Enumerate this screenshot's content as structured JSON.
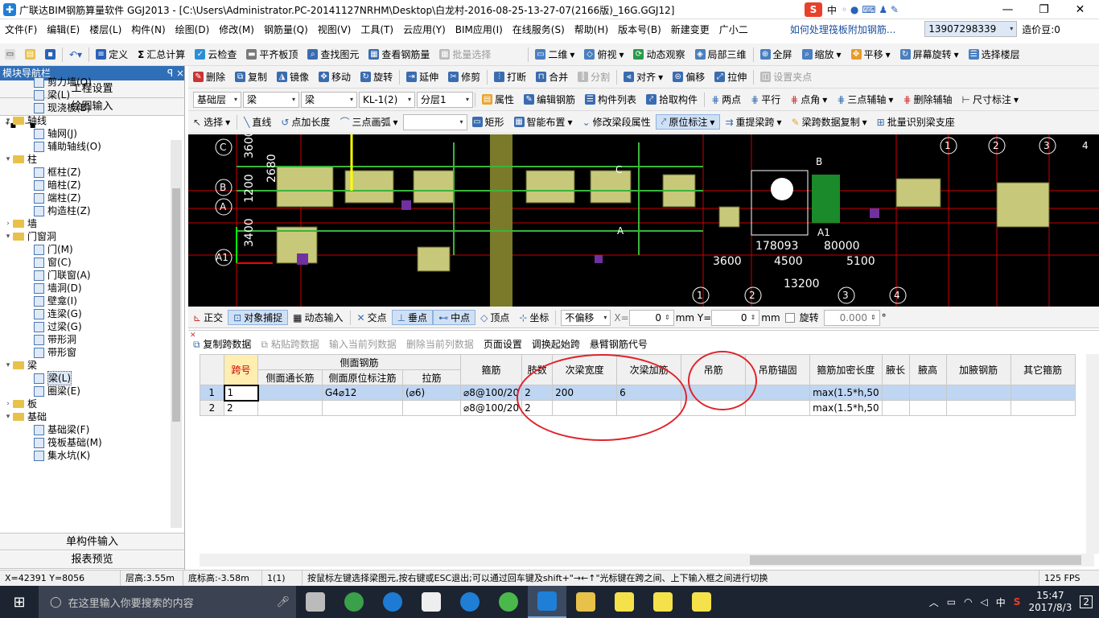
{
  "titlebar": {
    "title": "广联达BIM钢筋算量软件 GGJ2013 - [C:\\Users\\Administrator.PC-20141127NRHM\\Desktop\\白龙村-2016-08-25-13-27-07(2166版)_16G.GGJ12]",
    "ime_label": "中",
    "min": "—",
    "max": "❐",
    "close": "✕"
  },
  "menubar": {
    "items": [
      "文件(F)",
      "编辑(E)",
      "楼层(L)",
      "构件(N)",
      "绘图(D)",
      "修改(M)",
      "钢筋量(Q)",
      "视图(V)",
      "工具(T)",
      "云应用(Y)",
      "BIM应用(I)",
      "在线服务(S)",
      "帮助(H)",
      "版本号(B)",
      "新建变更",
      "广小二"
    ],
    "help_link": "如何处理筏板附加钢筋...",
    "phone": "13907298339",
    "price": "造价豆:0"
  },
  "toolbar1": {
    "items": [
      "定义",
      "汇总计算",
      "云检查",
      "平齐板顶",
      "查找图元",
      "查看钢筋量",
      "批量选择",
      "二维",
      "俯视",
      "动态观察",
      "局部三维",
      "全屏",
      "缩放",
      "平移",
      "屏幕旋转",
      "选择楼层"
    ]
  },
  "toolbar2": {
    "items": [
      "删除",
      "复制",
      "镜像",
      "移动",
      "旋转",
      "延伸",
      "修剪",
      "打断",
      "合并",
      "分割",
      "对齐",
      "偏移",
      "拉伸",
      "设置夹点"
    ]
  },
  "toolbar3": {
    "floor": "基础层",
    "type1": "梁",
    "type2": "梁",
    "component": "KL-1(2)",
    "layer": "分层1",
    "items": [
      "属性",
      "编辑钢筋",
      "构件列表",
      "拾取构件",
      "两点",
      "平行",
      "点角",
      "三点辅轴",
      "删除辅轴",
      "尺寸标注"
    ]
  },
  "toolbar4": {
    "items": [
      "选择",
      "直线",
      "点加长度",
      "三点画弧",
      "矩形",
      "智能布置",
      "修改梁段属性",
      "原位标注",
      "重提梁跨",
      "梁跨数据复制",
      "批量识别梁支座"
    ]
  },
  "leftpanel": {
    "header": "模块导航栏",
    "pin": "ꟼ ×",
    "btn_project": "工程设置",
    "btn_draw": "绘图输入",
    "btn_single": "单构件输入",
    "btn_report": "报表预览",
    "tree": [
      {
        "level": 2,
        "kind": "leaf",
        "label": "剪力墙(Q)"
      },
      {
        "level": 2,
        "kind": "leaf",
        "label": "梁(L)"
      },
      {
        "level": 2,
        "kind": "leaf",
        "label": "现浇板(B)"
      },
      {
        "level": 1,
        "kind": "folder",
        "label": "轴线",
        "exp": "▾"
      },
      {
        "level": 2,
        "kind": "leaf",
        "label": "轴网(J)"
      },
      {
        "level": 2,
        "kind": "leaf",
        "label": "辅助轴线(O)"
      },
      {
        "level": 1,
        "kind": "folder",
        "label": "柱",
        "exp": "▾"
      },
      {
        "level": 2,
        "kind": "leaf",
        "label": "框柱(Z)"
      },
      {
        "level": 2,
        "kind": "leaf",
        "label": "暗柱(Z)"
      },
      {
        "level": 2,
        "kind": "leaf",
        "label": "端柱(Z)"
      },
      {
        "level": 2,
        "kind": "leaf",
        "label": "构造柱(Z)"
      },
      {
        "level": 1,
        "kind": "folder",
        "label": "墙",
        "exp": "›"
      },
      {
        "level": 1,
        "kind": "folder",
        "label": "门窗洞",
        "exp": "▾"
      },
      {
        "level": 2,
        "kind": "leaf",
        "label": "门(M)"
      },
      {
        "level": 2,
        "kind": "leaf",
        "label": "窗(C)"
      },
      {
        "level": 2,
        "kind": "leaf",
        "label": "门联窗(A)"
      },
      {
        "level": 2,
        "kind": "leaf",
        "label": "墙洞(D)"
      },
      {
        "level": 2,
        "kind": "leaf",
        "label": "壁龛(I)"
      },
      {
        "level": 2,
        "kind": "leaf",
        "label": "连梁(G)"
      },
      {
        "level": 2,
        "kind": "leaf",
        "label": "过梁(G)"
      },
      {
        "level": 2,
        "kind": "leaf",
        "label": "带形洞"
      },
      {
        "level": 2,
        "kind": "leaf",
        "label": "带形窗"
      },
      {
        "level": 1,
        "kind": "folder",
        "label": "梁",
        "exp": "▾"
      },
      {
        "level": 2,
        "kind": "leaf",
        "label": "梁(L)",
        "selected": true
      },
      {
        "level": 2,
        "kind": "leaf",
        "label": "圈梁(E)"
      },
      {
        "level": 1,
        "kind": "folder",
        "label": "板",
        "exp": "›"
      },
      {
        "level": 1,
        "kind": "folder",
        "label": "基础",
        "exp": "▾"
      },
      {
        "level": 2,
        "kind": "leaf",
        "label": "基础梁(F)"
      },
      {
        "level": 2,
        "kind": "leaf",
        "label": "筏板基础(M)"
      },
      {
        "level": 2,
        "kind": "leaf",
        "label": "集水坑(K)"
      }
    ]
  },
  "canvas": {
    "axis_labels": [
      "C",
      "B",
      "A",
      "A1",
      "A",
      "B",
      "C",
      "1",
      "2",
      "3",
      "4",
      "1",
      "2",
      "3",
      "4",
      "A1"
    ],
    "dims": [
      "3600",
      "1200",
      "2680",
      "3400",
      "3600",
      "4500",
      "5100",
      "13200",
      "178093",
      "80000"
    ]
  },
  "snapbar": {
    "items": [
      "正交",
      "对象捕捉",
      "动态输入",
      "交点",
      "垂点",
      "中点",
      "顶点",
      "坐标",
      "不偏移"
    ],
    "x_label": "X=",
    "x_value": "0",
    "y_label": "mm Y=",
    "y_value": "0",
    "mm": "mm",
    "rotate": "旋转",
    "rotate_value": "0.000",
    "deg": "°"
  },
  "gridbar": {
    "items": [
      "复制跨数据",
      "粘贴跨数据",
      "输入当前列数据",
      "删除当前列数据",
      "页面设置",
      "调换起始跨",
      "悬臂钢筋代号"
    ]
  },
  "table": {
    "group_header": "侧面钢筋",
    "headers": [
      "跨号",
      "侧面通长筋",
      "侧面原位标注筋",
      "拉筋",
      "箍筋",
      "肢数",
      "次梁宽度",
      "次梁加筋",
      "吊筋",
      "吊筋锚固",
      "箍筋加密长度",
      "腋长",
      "腋高",
      "加腋钢筋",
      "其它箍筋"
    ],
    "rows": [
      {
        "rn": "1",
        "cells": [
          "1",
          "",
          "G4⌀12",
          "(⌀6)",
          "⌀8@100/20",
          "2",
          "200",
          "6",
          "",
          "",
          "max(1.5*h,50",
          "",
          "",
          "",
          ""
        ]
      },
      {
        "rn": "2",
        "cells": [
          "2",
          "",
          "",
          "",
          "⌀8@100/20",
          "2",
          "",
          "",
          "",
          "",
          "max(1.5*h,50",
          "",
          "",
          "",
          ""
        ]
      }
    ]
  },
  "statusbar": {
    "coords": "X=42391 Y=8056",
    "floor_height": "层高:3.55m",
    "bottom_height": "底标高:-3.58m",
    "span": "1(1)",
    "hint": "按鼠标左键选择梁图元,按右键或ESC退出;可以通过回车键及shift+\"→←↑\"光标键在跨之间、上下输入框之间进行切换",
    "fps": "125 FPS"
  },
  "taskbar": {
    "search_placeholder": "在这里输入你要搜索的内容",
    "time": "15:47",
    "date": "2017/8/3",
    "lang": "中",
    "notif": "2"
  }
}
